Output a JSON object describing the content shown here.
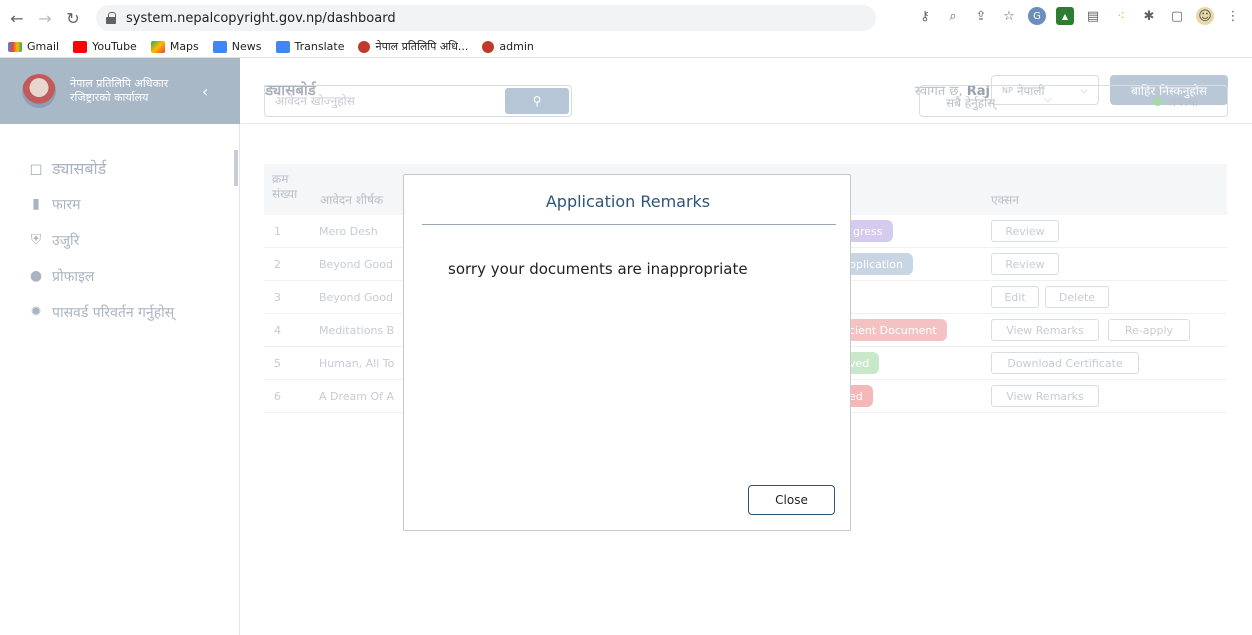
{
  "browser": {
    "url": "system.nepalcopyright.gov.np/dashboard",
    "bookmarks": [
      "Gmail",
      "YouTube",
      "Maps",
      "News",
      "Translate",
      "नेपाल प्रतिलिपि अधि...",
      "admin"
    ]
  },
  "sidebar": {
    "brand_line1": "नेपाल प्रतिलिपि अधिकार",
    "brand_line2": "रजिष्ट्रारको कार्यालय",
    "items": [
      {
        "label": "ड्यासबोर्ड",
        "icon": "dashboard-icon"
      },
      {
        "label": "फारम",
        "icon": "file-icon"
      },
      {
        "label": "उजुरि",
        "icon": "shield-icon"
      },
      {
        "label": "प्रोफाइल",
        "icon": "user-icon"
      },
      {
        "label": "पासवर्ड परिवर्तन गर्नुहोस्",
        "icon": "gear-icon"
      }
    ]
  },
  "header": {
    "title": "ड्यासबोर्ड",
    "welcome": "स्वागत छ,",
    "user": "Raj",
    "lang_code": "NP",
    "lang_label": "नेपाली",
    "logout": "बाहिर निस्कनुहोस"
  },
  "search": {
    "placeholder": "आवेदन खोज्नुहोस"
  },
  "filter": {
    "label": "सबै हेर्नुहोस्",
    "status": "अवस्था"
  },
  "table": {
    "col_sn": "क्रम संख्या",
    "col_title": "आवेदन शीर्षक",
    "col_action": "एक्सन",
    "rows": [
      {
        "sn": "1",
        "title": "Mero Desh",
        "status": "gress",
        "actions": [
          "Review"
        ]
      },
      {
        "sn": "2",
        "title": "Beyond Good",
        "status": "pplication",
        "actions": [
          "Review"
        ]
      },
      {
        "sn": "3",
        "title": "Beyond Good",
        "status": "",
        "actions": [
          "Edit",
          "Delete"
        ]
      },
      {
        "sn": "4",
        "title": "Meditations B",
        "status": "cient Document",
        "actions": [
          "View Remarks",
          "Re-apply"
        ]
      },
      {
        "sn": "5",
        "title": "Human, All To",
        "status": "ved",
        "actions": [
          "Download Certificate"
        ]
      },
      {
        "sn": "6",
        "title": "A Dream Of A",
        "status": "ed",
        "actions": [
          "View Remarks"
        ]
      }
    ]
  },
  "modal": {
    "title": "Application Remarks",
    "body": "sorry your documents are inappropriate",
    "close": "Close"
  },
  "colors": {
    "accent": "#2d5479",
    "sidebar_brand": "#a9b8c7"
  }
}
